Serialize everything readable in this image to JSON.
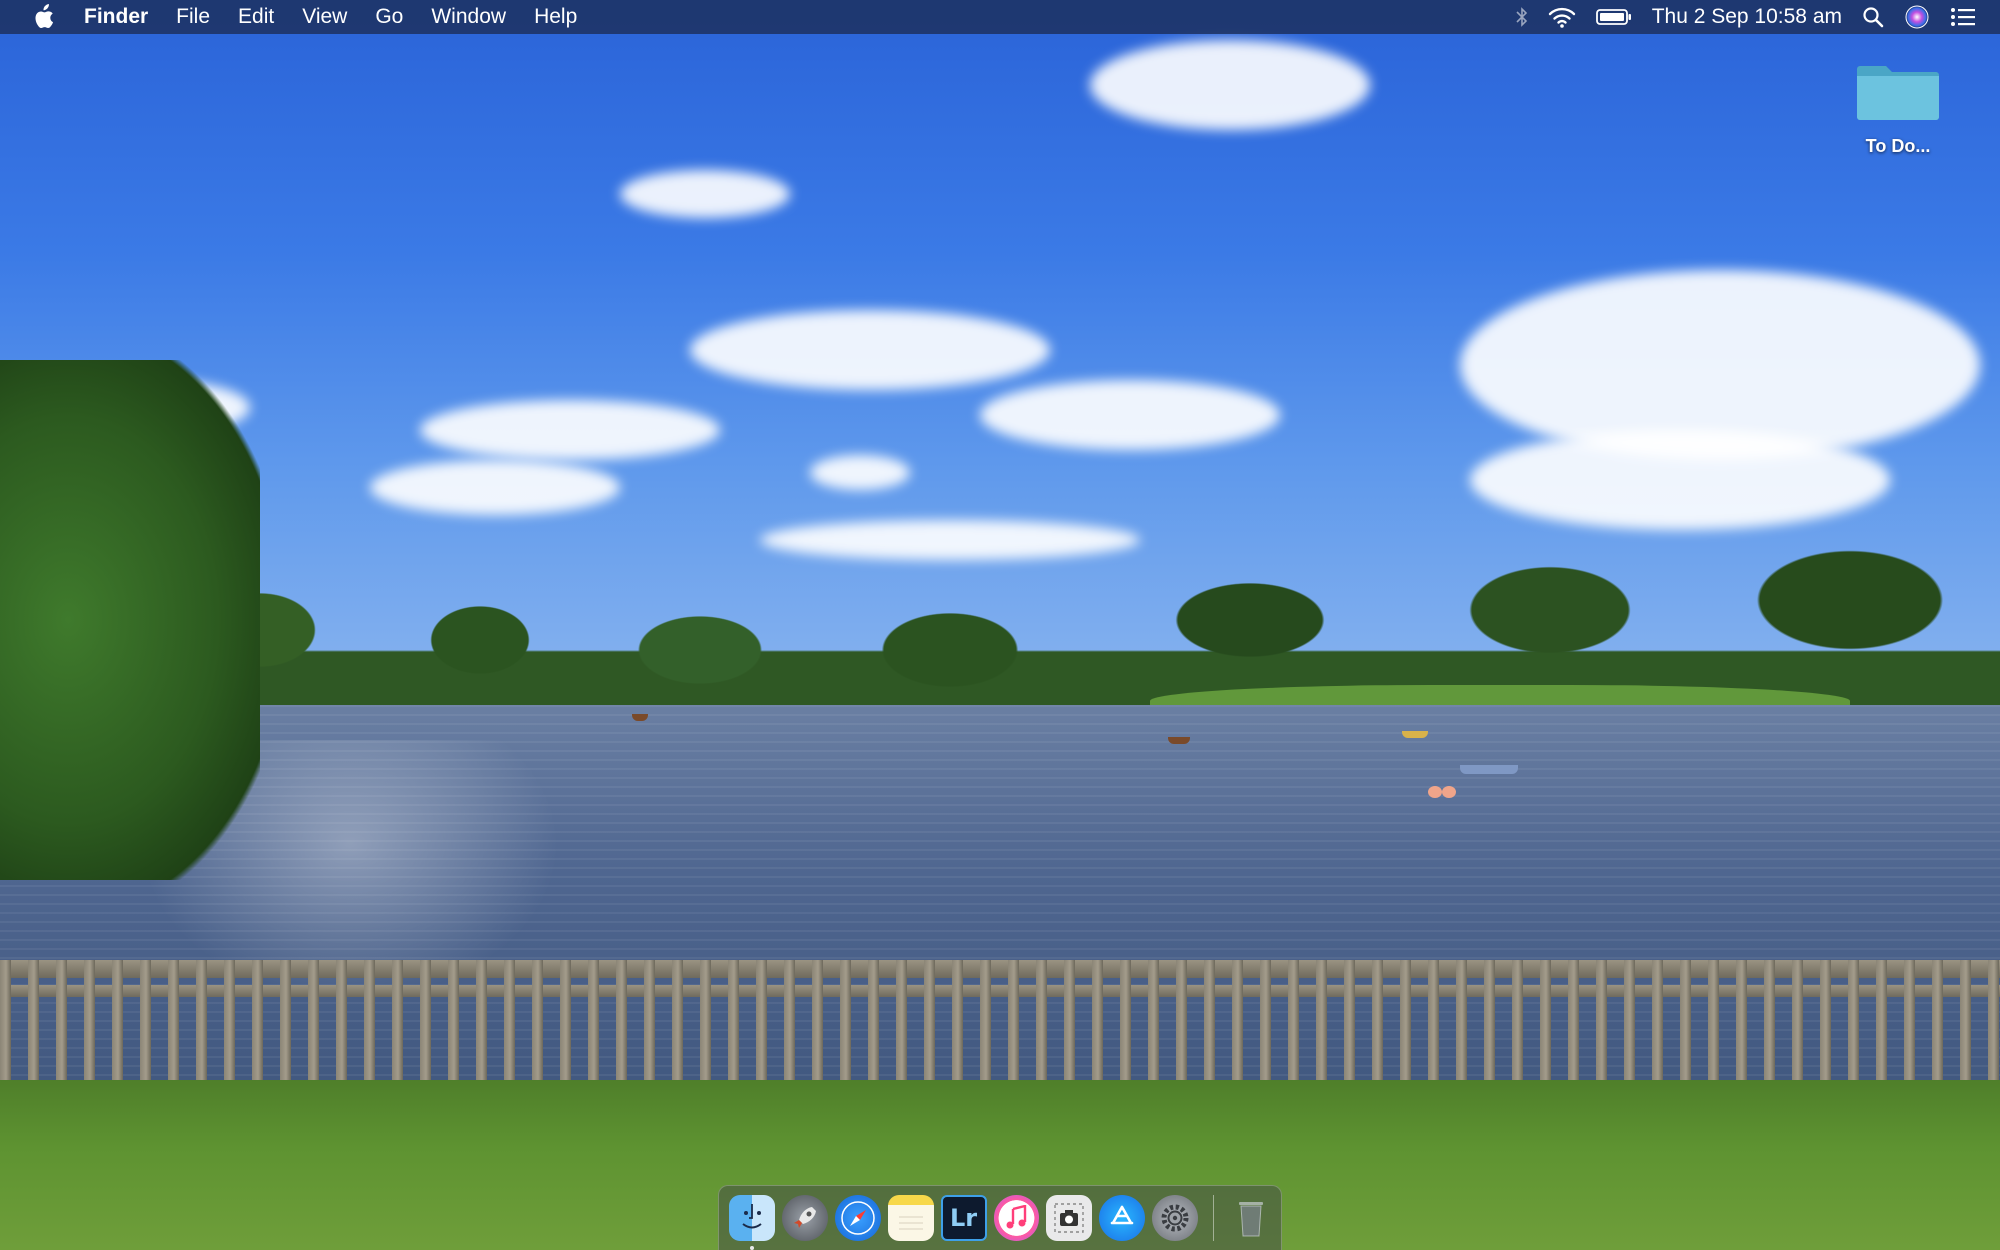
{
  "menubar": {
    "app_name": "Finder",
    "menus": [
      "File",
      "Edit",
      "View",
      "Go",
      "Window",
      "Help"
    ],
    "clock": "Thu 2 Sep  10:58 am",
    "status_icons": [
      "bluetooth-icon",
      "wifi-icon",
      "battery-icon",
      "spotlight-icon",
      "siri-icon",
      "notification-center-icon"
    ]
  },
  "desktop": {
    "icons": [
      {
        "label": "To Do...",
        "icon": "folder-icon",
        "color": "#5fb9d6"
      }
    ]
  },
  "dock": {
    "apps": [
      {
        "name": "Finder",
        "icon": "finder-icon",
        "running": true
      },
      {
        "name": "Launchpad",
        "icon": "launchpad-icon",
        "running": false
      },
      {
        "name": "Safari",
        "icon": "safari-icon",
        "running": false
      },
      {
        "name": "Notes",
        "icon": "notes-icon",
        "running": false
      },
      {
        "name": "Lightroom",
        "icon": "lightroom-icon",
        "glyph": "Lr",
        "running": false
      },
      {
        "name": "iTunes",
        "icon": "itunes-icon",
        "running": false
      },
      {
        "name": "Screenshot",
        "icon": "screenshot-icon",
        "running": false
      },
      {
        "name": "App Store",
        "icon": "app-store-icon",
        "running": false
      },
      {
        "name": "System Preferences",
        "icon": "system-preferences-icon",
        "running": false
      }
    ],
    "trash": {
      "name": "Trash",
      "icon": "trash-icon"
    }
  },
  "colors": {
    "menubar_bg": "#1c2e5a",
    "sky": "#3b7ae6",
    "water": "#4f6690"
  }
}
